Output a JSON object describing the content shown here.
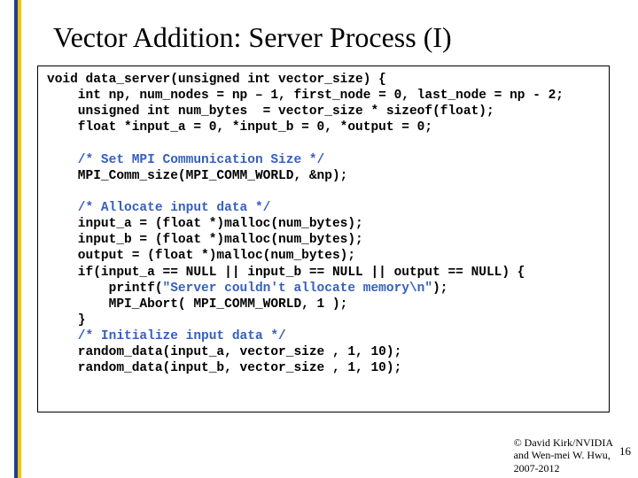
{
  "title": "Vector Addition: Server Process (I)",
  "code": {
    "l1": "void data_server(unsigned int vector_size) {",
    "l2": "    int np, num_nodes = np – 1, first_node = 0, last_node = np - 2;",
    "l3": "    unsigned int num_bytes  = vector_size * sizeof(float);",
    "l4": "    float *input_a = 0, *input_b = 0, *output = 0;",
    "l5": "",
    "c1": "    /* Set MPI Communication Size */",
    "l6": "    MPI_Comm_size(MPI_COMM_WORLD, &np);",
    "l7": "",
    "c2": "    /* Allocate input data */",
    "l8": "    input_a = (float *)malloc(num_bytes);",
    "l9": "    input_b = (float *)malloc(num_bytes);",
    "l10": "    output = (float *)malloc(num_bytes);",
    "l11": "    if(input_a == NULL || input_b == NULL || output == NULL) {",
    "l12a": "        printf(",
    "s1": "\"Server couldn't allocate memory\\n\"",
    "l12b": ");",
    "l13": "        MPI_Abort( MPI_COMM_WORLD, 1 );",
    "l14": "    }",
    "c3": "    /* Initialize input data */",
    "l15": "    random_data(input_a, vector_size , 1, 10);",
    "l16": "    random_data(input_b, vector_size , 1, 10);"
  },
  "footer": {
    "line1": "© David Kirk/NVIDIA",
    "line2": "and Wen-mei W. Hwu,",
    "line3": "2007-2012"
  },
  "page": "16"
}
